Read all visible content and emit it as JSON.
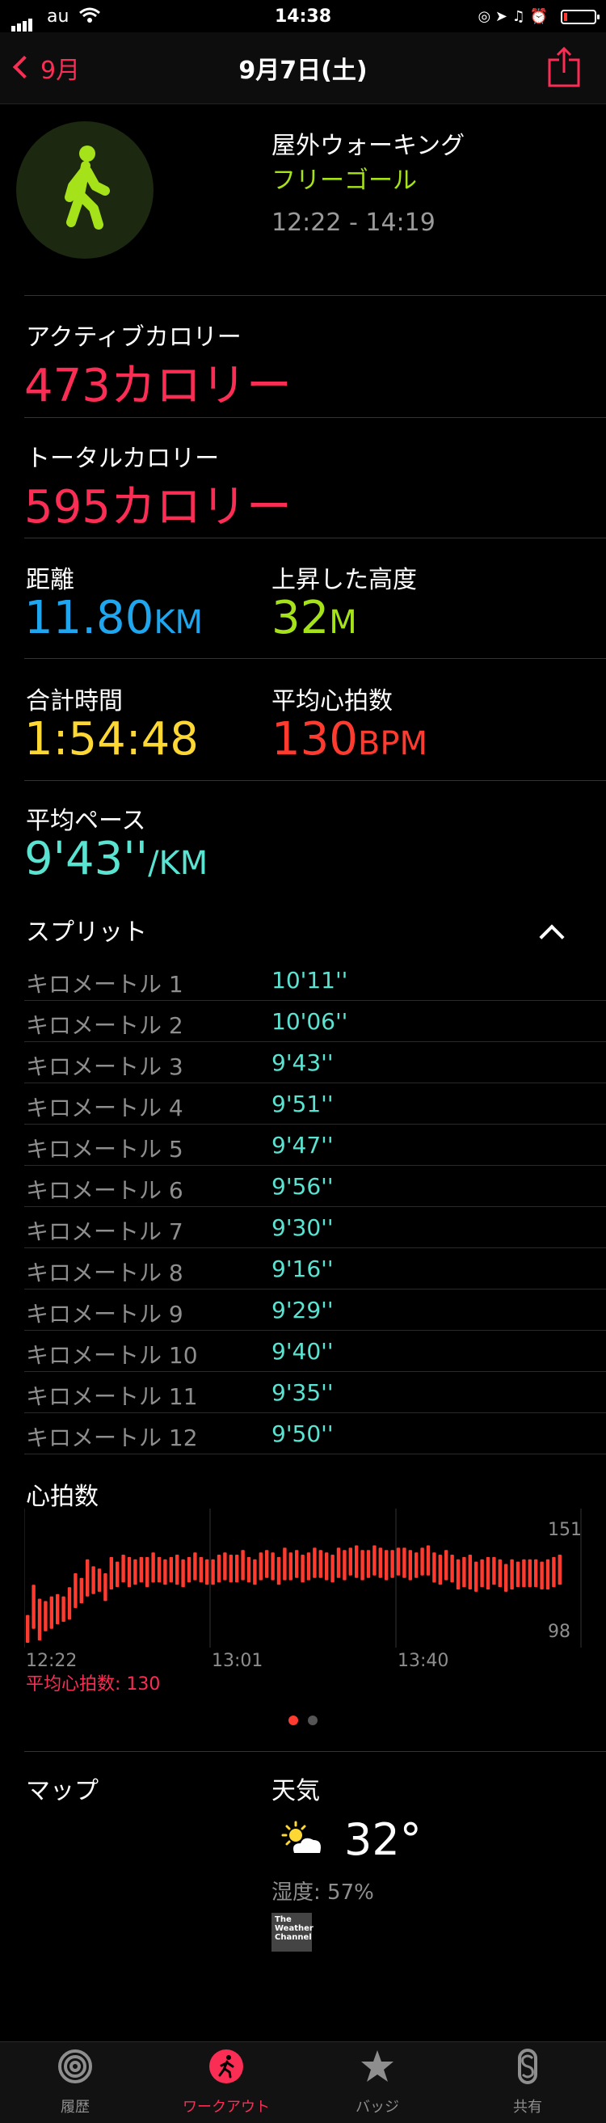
{
  "status_bar": {
    "carrier": "au",
    "time": "14:38"
  },
  "nav": {
    "back_label": "9月",
    "title": "9月7日(土)"
  },
  "workout": {
    "type": "屋外ウォーキング",
    "goal": "フリーゴール",
    "time_range": "12:22 - 14:19"
  },
  "metrics": {
    "active_calories": {
      "label": "アクティブカロリー",
      "value": "473",
      "unit": "カロリー"
    },
    "total_calories": {
      "label": "トータルカロリー",
      "value": "595",
      "unit": "カロリー"
    },
    "distance": {
      "label": "距離",
      "value": "11.80",
      "unit": "KM"
    },
    "elevation_gain": {
      "label": "上昇した高度",
      "value": "32",
      "unit": "M"
    },
    "total_time": {
      "label": "合計時間",
      "value": "1:54:48"
    },
    "avg_heart_rate": {
      "label": "平均心拍数",
      "value": "130",
      "unit": "BPM"
    },
    "avg_pace": {
      "label": "平均ペース",
      "value": "9'43''",
      "unit": "/KM"
    }
  },
  "splits": {
    "title": "スプリット",
    "rows": [
      {
        "label": "キロメートル 1",
        "value": "10'11''"
      },
      {
        "label": "キロメートル 2",
        "value": "10'06''"
      },
      {
        "label": "キロメートル 3",
        "value": "9'43''"
      },
      {
        "label": "キロメートル 4",
        "value": "9'51''"
      },
      {
        "label": "キロメートル 5",
        "value": "9'47''"
      },
      {
        "label": "キロメートル 6",
        "value": "9'56''"
      },
      {
        "label": "キロメートル 7",
        "value": "9'30''"
      },
      {
        "label": "キロメートル 8",
        "value": "9'16''"
      },
      {
        "label": "キロメートル 9",
        "value": "9'29''"
      },
      {
        "label": "キロメートル 10",
        "value": "9'40''"
      },
      {
        "label": "キロメートル 11",
        "value": "9'35''"
      },
      {
        "label": "キロメートル 12",
        "value": "9'50''"
      }
    ]
  },
  "heart_rate": {
    "title": "心拍数",
    "avg_label": "平均心拍数: 130",
    "page_index": 0,
    "page_count": 2
  },
  "chart_data": {
    "type": "bar",
    "title": "心拍数",
    "x_tick_labels": [
      "12:22",
      "13:01",
      "13:40"
    ],
    "x_ticks_minutes": [
      0,
      39,
      78
    ],
    "x_range_minutes": [
      0,
      117
    ],
    "y_tick_labels": [
      "151",
      "98"
    ],
    "ylim": [
      98,
      151
    ],
    "grid": true,
    "series": [
      {
        "color": "#ff3b30",
        "ranges": [
          [
            98,
            110
          ],
          [
            104,
            123
          ],
          [
            99,
            117
          ],
          [
            103,
            116
          ],
          [
            104,
            118
          ],
          [
            106,
            119
          ],
          [
            107,
            118
          ],
          [
            108,
            122
          ],
          [
            113,
            128
          ],
          [
            115,
            126
          ],
          [
            118,
            134
          ],
          [
            119,
            131
          ],
          [
            120,
            130
          ],
          [
            116,
            128
          ],
          [
            121,
            135
          ],
          [
            122,
            133
          ],
          [
            124,
            136
          ],
          [
            122,
            135
          ],
          [
            123,
            134
          ],
          [
            124,
            135
          ],
          [
            122,
            135
          ],
          [
            124,
            137
          ],
          [
            124,
            135
          ],
          [
            123,
            134
          ],
          [
            124,
            135
          ],
          [
            123,
            136
          ],
          [
            122,
            134
          ],
          [
            124,
            135
          ],
          [
            125,
            137
          ],
          [
            124,
            135
          ],
          [
            123,
            134
          ],
          [
            123,
            134
          ],
          [
            124,
            136
          ],
          [
            125,
            137
          ],
          [
            124,
            136
          ],
          [
            124,
            136
          ],
          [
            125,
            138
          ],
          [
            124,
            135
          ],
          [
            123,
            134
          ],
          [
            125,
            137
          ],
          [
            126,
            138
          ],
          [
            125,
            137
          ],
          [
            123,
            135
          ],
          [
            125,
            139
          ],
          [
            125,
            137
          ],
          [
            126,
            138
          ],
          [
            124,
            136
          ],
          [
            125,
            137
          ],
          [
            126,
            139
          ],
          [
            126,
            138
          ],
          [
            125,
            137
          ],
          [
            124,
            136
          ],
          [
            126,
            139
          ],
          [
            125,
            138
          ],
          [
            127,
            139
          ],
          [
            126,
            140
          ],
          [
            125,
            138
          ],
          [
            126,
            138
          ],
          [
            127,
            140
          ],
          [
            126,
            139
          ],
          [
            125,
            138
          ],
          [
            126,
            138
          ],
          [
            127,
            139
          ],
          [
            126,
            139
          ],
          [
            125,
            138
          ],
          [
            126,
            137
          ],
          [
            127,
            139
          ],
          [
            127,
            140
          ],
          [
            124,
            137
          ],
          [
            123,
            136
          ],
          [
            125,
            138
          ],
          [
            124,
            136
          ],
          [
            121,
            134
          ],
          [
            122,
            135
          ],
          [
            121,
            136
          ],
          [
            120,
            133
          ],
          [
            122,
            134
          ],
          [
            121,
            135
          ],
          [
            123,
            135
          ],
          [
            122,
            134
          ],
          [
            120,
            132
          ],
          [
            121,
            134
          ],
          [
            122,
            133
          ],
          [
            122,
            134
          ],
          [
            122,
            134
          ],
          [
            122,
            134
          ],
          [
            121,
            133
          ],
          [
            121,
            134
          ],
          [
            122,
            135
          ],
          [
            123,
            136
          ]
        ]
      }
    ]
  },
  "map": {
    "title": "マップ"
  },
  "weather": {
    "title": "天気",
    "icon": "partly-sunny-icon",
    "temperature": "32°",
    "humidity": "湿度: 57%",
    "provider_logo_text": "The Weather Channel"
  },
  "tabs": [
    {
      "label": "履歴",
      "icon": "rings-icon",
      "active": false
    },
    {
      "label": "ワークアウト",
      "icon": "running-icon",
      "active": true
    },
    {
      "label": "バッジ",
      "icon": "star-badge-icon",
      "active": false
    },
    {
      "label": "共有",
      "icon": "share-s-icon",
      "active": false
    }
  ],
  "colors": {
    "accent": "#fa2d55",
    "active_calories": "#fa2d55",
    "distance": "#1ea6ee",
    "elevation": "#a6e21a",
    "time": "#fdd835",
    "heart_rate": "#ff3b30",
    "pace": "#5be3d2",
    "goal": "#a6e21a"
  }
}
